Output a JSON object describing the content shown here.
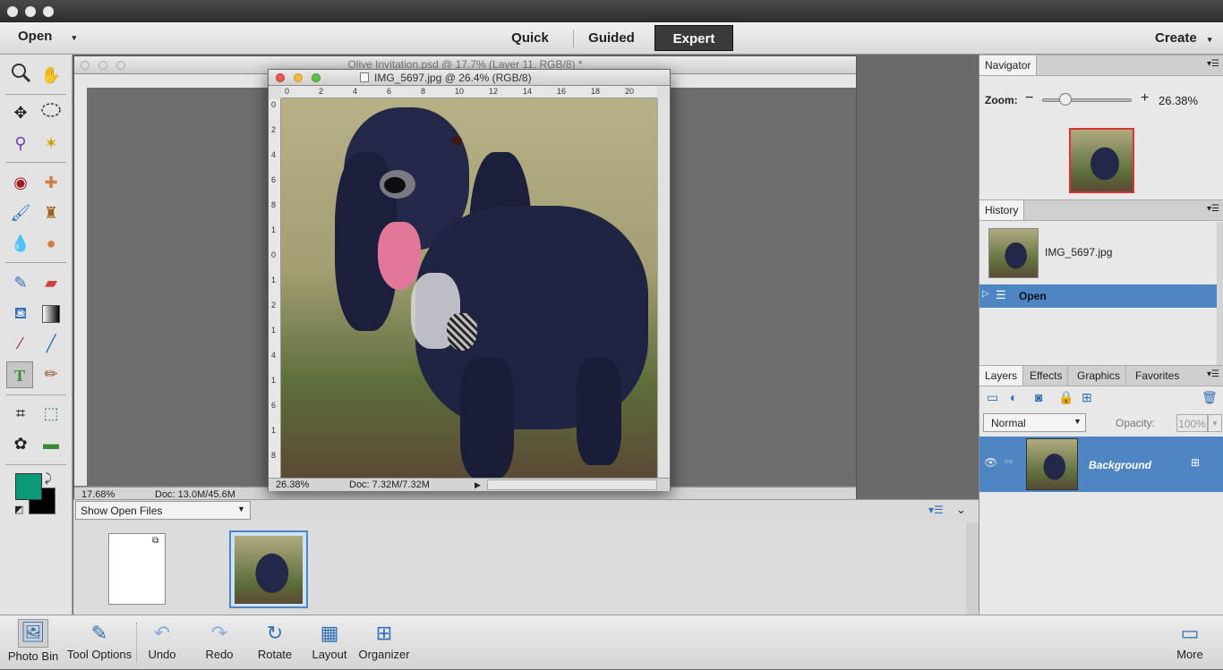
{
  "modebar": {
    "open_label": "Open",
    "tabs": [
      "Quick",
      "Guided",
      "Expert"
    ],
    "create_label": "Create"
  },
  "bg_doc": {
    "title": "Olive Invitation.psd @ 17.7% (Layer 11, RGB/8) *",
    "zoom": "17.68%",
    "doc_size": "Doc: 13.0M/45.6M"
  },
  "front_doc": {
    "title": "IMG_5697.jpg @ 26.4% (RGB/8)",
    "zoom": "26.38%",
    "doc_size": "Doc: 7.32M/7.32M",
    "ruler_top": [
      "0",
      "2",
      "4",
      "6",
      "8",
      "10",
      "12",
      "14",
      "16",
      "18",
      "20"
    ],
    "ruler_left": [
      "0",
      "2",
      "4",
      "6",
      "8",
      "1",
      "0",
      "1",
      "2",
      "1",
      "4",
      "1",
      "6",
      "1",
      "8"
    ]
  },
  "bin": {
    "dropdown_label": "Show Open Files"
  },
  "navigator": {
    "tab": "Navigator",
    "zoom_label": "Zoom:",
    "zoom_value": "26.38%",
    "zoom_level": 0.26
  },
  "history": {
    "tab": "History",
    "snapshot_name": "IMG_5697.jpg",
    "step": "Open"
  },
  "layers": {
    "tabs": [
      "Layers",
      "Effects",
      "Graphics",
      "Favorites"
    ],
    "blend_mode": "Normal",
    "opacity_label": "Opacity:",
    "opacity_value": "100%",
    "layer_name": "Background"
  },
  "bottombar": {
    "items": [
      "Photo Bin",
      "Tool Options",
      "Undo",
      "Redo",
      "Rotate",
      "Layout",
      "Organizer"
    ],
    "more_label": "More"
  },
  "colors": {
    "foreground": "#0a9a78",
    "background": "#000000",
    "selection_blue": "#4d86c3"
  }
}
